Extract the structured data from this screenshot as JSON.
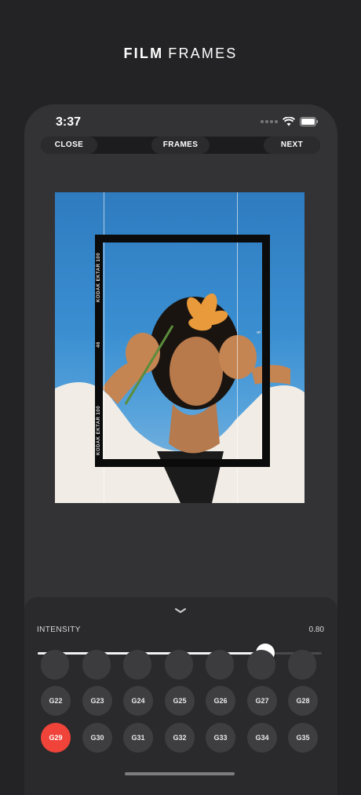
{
  "promo": {
    "title_bold": "FILM",
    "title_light": "FRAMES"
  },
  "status": {
    "time": "3:37"
  },
  "toolbar": {
    "close_label": "CLOSE",
    "frames_label": "FRAMES",
    "next_label": "NEXT"
  },
  "frame_overlay": {
    "left_text": "KODAK  EKTAR 100",
    "left_text_2": "KODAK  EKTAR 100",
    "frame_number": "46",
    "right_number": "5"
  },
  "panel": {
    "intensity_label": "INTENSITY",
    "intensity_value": "0.80",
    "intensity": 0.8,
    "grid": [
      [
        "G22",
        "G23",
        "G24",
        "G25",
        "G26",
        "G27",
        "G28"
      ],
      [
        "G29",
        "G30",
        "G31",
        "G32",
        "G33",
        "G34",
        "G35"
      ]
    ],
    "selected": "G29"
  },
  "colors": {
    "accent": "#f0433a",
    "background": "#232325",
    "phone": "#333335"
  }
}
